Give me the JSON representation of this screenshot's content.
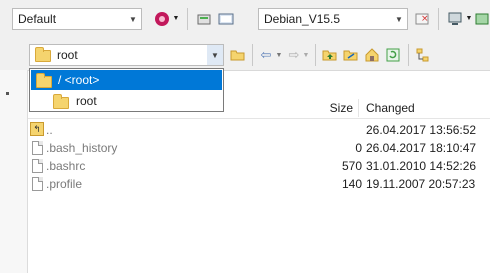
{
  "toolbar": {
    "session_combo": "Default",
    "remote_combo": "Debian_V15.5",
    "path_combo": "root"
  },
  "dropdown": {
    "items": [
      {
        "label": "/ <root>",
        "selected": true
      },
      {
        "label": "root",
        "selected": false
      }
    ]
  },
  "columns": {
    "size": "Size",
    "changed": "Changed"
  },
  "files": [
    {
      "name": "..",
      "size": "",
      "changed": "26.04.2017 13:56:52",
      "icon": "parent-dir-icon"
    },
    {
      "name": ".bash_history",
      "size": "0",
      "changed": "26.04.2017 18:10:47",
      "icon": "file-icon"
    },
    {
      "name": ".bashrc",
      "size": "570",
      "changed": "31.01.2010 14:52:26",
      "icon": "file-icon"
    },
    {
      "name": ".profile",
      "size": "140",
      "changed": "19.11.2007 20:57:23",
      "icon": "file-icon"
    }
  ],
  "colors": {
    "selection": "#0078d7",
    "folder": "#f5d46e"
  }
}
